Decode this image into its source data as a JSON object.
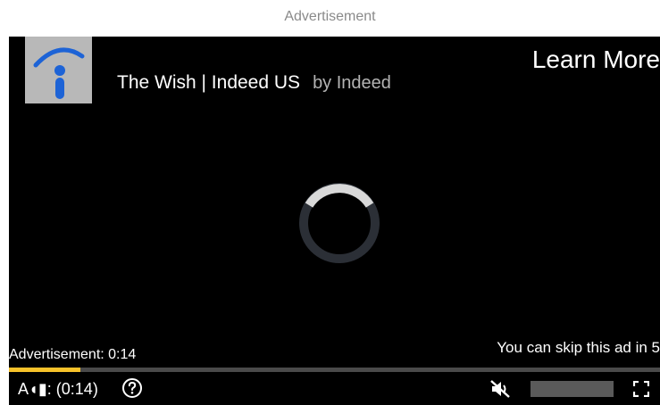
{
  "header": {
    "ad_label": "Advertisement"
  },
  "ad": {
    "logo_icon": "indeed-logo-icon",
    "title": "The Wish | Indeed US",
    "by_line": "by Indeed",
    "learn_more": "Learn More"
  },
  "player": {
    "spinner_icon": "loading-spinner-icon",
    "countdown": "Advertisement: 0:14",
    "skip_message": "You can skip this ad in 5",
    "progress_fraction": 0.11,
    "progress_color": "#f7c22a",
    "controls": {
      "ad_time": "A◖▮: (0:14)",
      "help_icon": "help-icon",
      "mute_icon": "muted-speaker-icon",
      "fullscreen_icon": "fullscreen-icon"
    }
  }
}
